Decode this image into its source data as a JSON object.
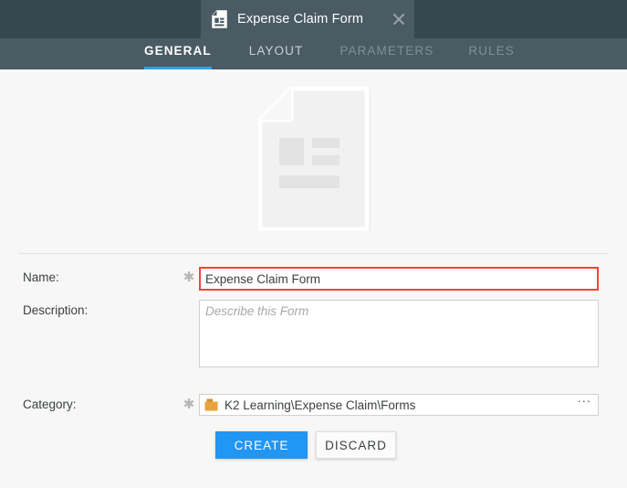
{
  "window": {
    "tab": {
      "title": "Expense Claim Form",
      "icon": "document-icon",
      "close_icon": "close-icon"
    }
  },
  "nav": {
    "tabs": [
      {
        "label": "GENERAL",
        "state": "active"
      },
      {
        "label": "LAYOUT",
        "state": "enabled"
      },
      {
        "label": "PARAMETERS",
        "state": "disabled"
      },
      {
        "label": "RULES",
        "state": "disabled"
      }
    ]
  },
  "hero": {
    "icon": "document-illustration"
  },
  "form": {
    "name": {
      "label": "Name:",
      "required_marker": "✱",
      "value": "Expense Claim Form",
      "placeholder": ""
    },
    "description": {
      "label": "Description:",
      "value": "",
      "placeholder": "Describe this Form"
    },
    "category": {
      "label": "Category:",
      "required_marker": "✱",
      "icon": "folder-icon",
      "value": "K2 Learning\\Expense Claim\\Forms",
      "browse_label": "···"
    }
  },
  "actions": {
    "create_label": "CREATE",
    "discard_label": "DISCARD"
  },
  "colors": {
    "titlebar": "#37474f",
    "navbar": "#4a5b63",
    "accent": "#2fa3e8",
    "primary_button": "#2196f3",
    "highlight_border": "#f44336",
    "page_background": "#f7f7f7",
    "folder": "#e8a33d"
  }
}
